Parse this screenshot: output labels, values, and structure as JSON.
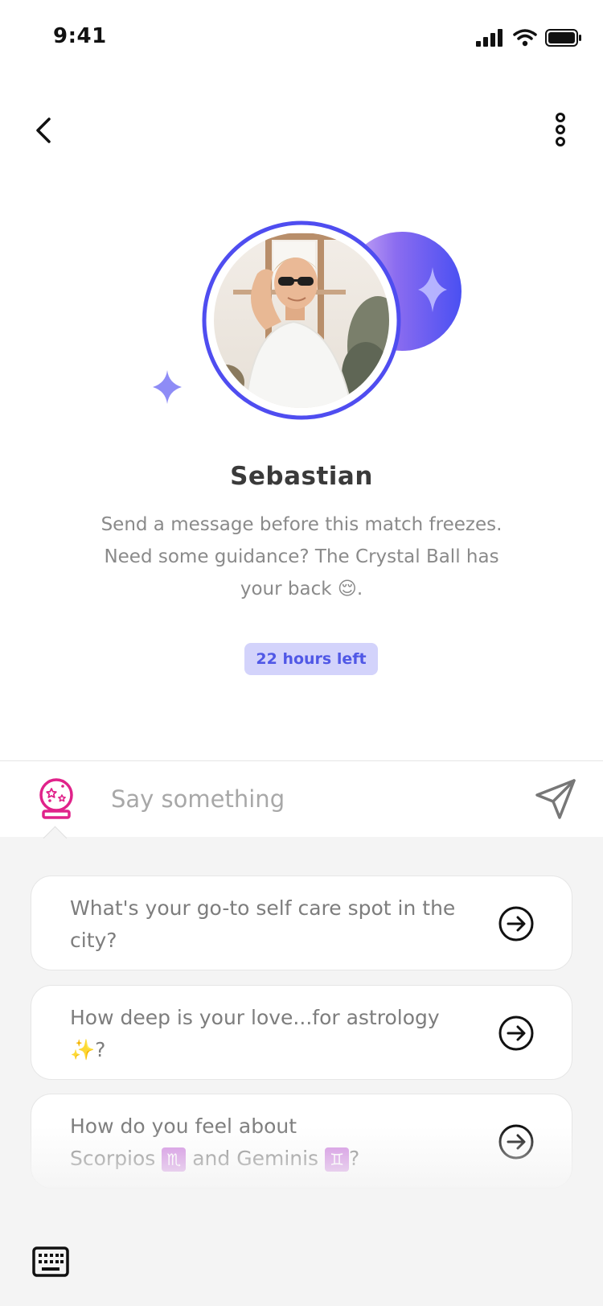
{
  "status_bar": {
    "time": "9:41"
  },
  "profile": {
    "name": "Sebastian",
    "description": "Send a message before this match freezes. Need some guidance? The Crystal Ball has your back 😌.",
    "timer_badge": "22 hours left"
  },
  "composer": {
    "placeholder": "Say something"
  },
  "suggestions": [
    {
      "text": "What's your go-to self care spot in the city?"
    },
    {
      "text_before": "How deep is your love...for astrology ",
      "emoji": "✨",
      "text_after": "?"
    },
    {
      "line1": "How do you feel about",
      "part_a": "Scorpios ",
      "zodiac_a": "♏",
      "part_b": " and Geminis ",
      "zodiac_b": "♊",
      "part_c": "?"
    }
  ],
  "colors": {
    "accent": "#5058e6",
    "badge_bg": "#d3d3fb",
    "crystal_ball": "#e0228a",
    "zodiac_tile": "#cf86e0"
  },
  "icons": [
    "signal-icon",
    "wifi-icon",
    "battery-icon",
    "back-chevron-icon",
    "more-vertical-icon",
    "sparkle-icon",
    "crystal-ball-icon",
    "send-icon",
    "arrow-circle-right-icon",
    "keyboard-icon"
  ]
}
